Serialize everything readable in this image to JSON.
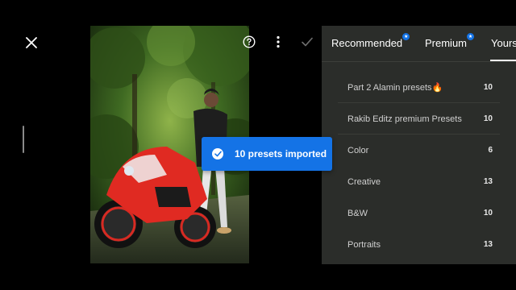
{
  "icons": {
    "close": "close-icon",
    "help": "help-icon",
    "more": "more-vertical-icon",
    "confirm": "checkmark-icon",
    "toast_check": "checkmark-circle-icon"
  },
  "colors": {
    "accent": "#1473e6",
    "panel_bg": "#2b2d2a"
  },
  "tabs": [
    {
      "label": "Recommended",
      "badge": "★"
    },
    {
      "label": "Premium",
      "badge": "★"
    },
    {
      "label": "Yours",
      "active": true
    }
  ],
  "presets": [
    {
      "name": "Part 2 Alamin presets🔥",
      "count": "10"
    },
    {
      "name": "Rakib Editz premium Presets",
      "count": "10"
    },
    {
      "name": "Color",
      "count": "6"
    },
    {
      "name": "Creative",
      "count": "13"
    },
    {
      "name": "B&W",
      "count": "10"
    },
    {
      "name": "Portraits",
      "count": "13"
    }
  ],
  "toast": {
    "message": "10 presets imported"
  }
}
